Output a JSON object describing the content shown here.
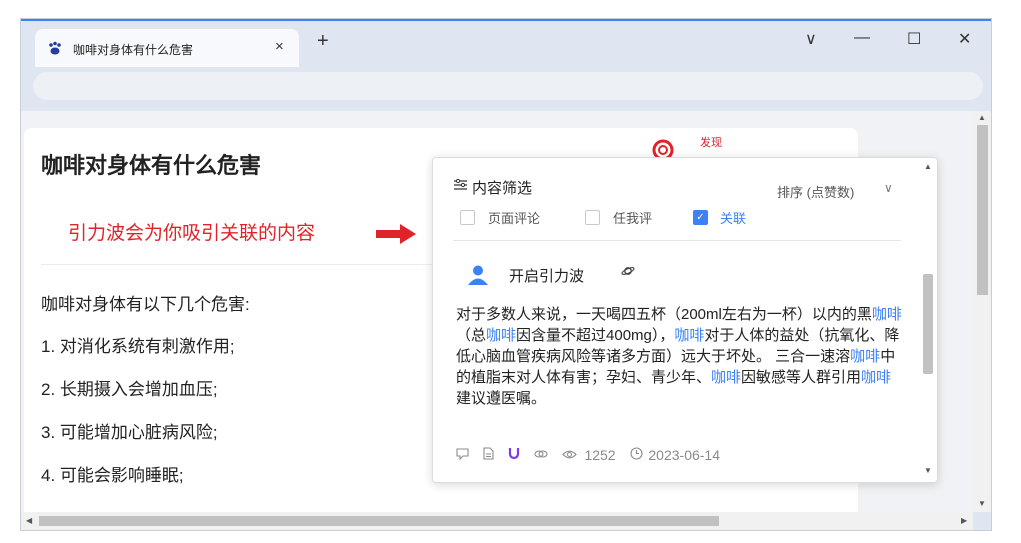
{
  "tab": {
    "title": "咖啡对身体有什么危害",
    "close": "×",
    "new": "+"
  },
  "window": {
    "dropdown": "∨",
    "minimize": "—",
    "maximize": "☐",
    "close": "✕"
  },
  "page": {
    "title": "咖啡对身体有什么危害",
    "hint": "引力波会为你吸引关联的内容",
    "discover": "发现",
    "lines": [
      "咖啡对身体有以下几个危害:",
      "1. 对消化系统有刺激作用;",
      "2. 长期摄入会增加血压;",
      "3. 可能增加心脏病风险;",
      "4. 可能会影响睡眠;"
    ]
  },
  "panel": {
    "filter_label": "内容筛选",
    "sort_label": "排序 (点赞数)",
    "checkboxes": [
      {
        "label": "页面评论",
        "checked": false
      },
      {
        "label": "任我评",
        "checked": false
      },
      {
        "label": "关联",
        "checked": true
      }
    ],
    "author": "开启引力波",
    "answer_parts": [
      {
        "t": "对于多数人来说，一天喝四五杯（200ml左右为一杯）以内的黑"
      },
      {
        "t": "咖啡",
        "kw": true
      },
      {
        "t": "（总"
      },
      {
        "t": "咖啡",
        "kw": true
      },
      {
        "t": "因含量不超过400mg），"
      },
      {
        "t": "咖啡",
        "kw": true
      },
      {
        "t": "对于人体的益处（抗氧化、降低心脑血管疾病风险等诸多方面）远大于坏处。 三合一速溶"
      },
      {
        "t": "咖啡",
        "kw": true
      },
      {
        "t": "中的植脂末对人体有害；孕妇、青少年、"
      },
      {
        "t": "咖啡",
        "kw": true
      },
      {
        "t": "因敏感等人群引用"
      },
      {
        "t": "咖啡",
        "kw": true
      },
      {
        "t": "建议遵医嘱。"
      }
    ],
    "views": "1252",
    "date": "2023-06-14"
  },
  "colors": {
    "accent": "#3b82f6",
    "hint": "#e0232a",
    "keyword": "#3b82f6"
  }
}
